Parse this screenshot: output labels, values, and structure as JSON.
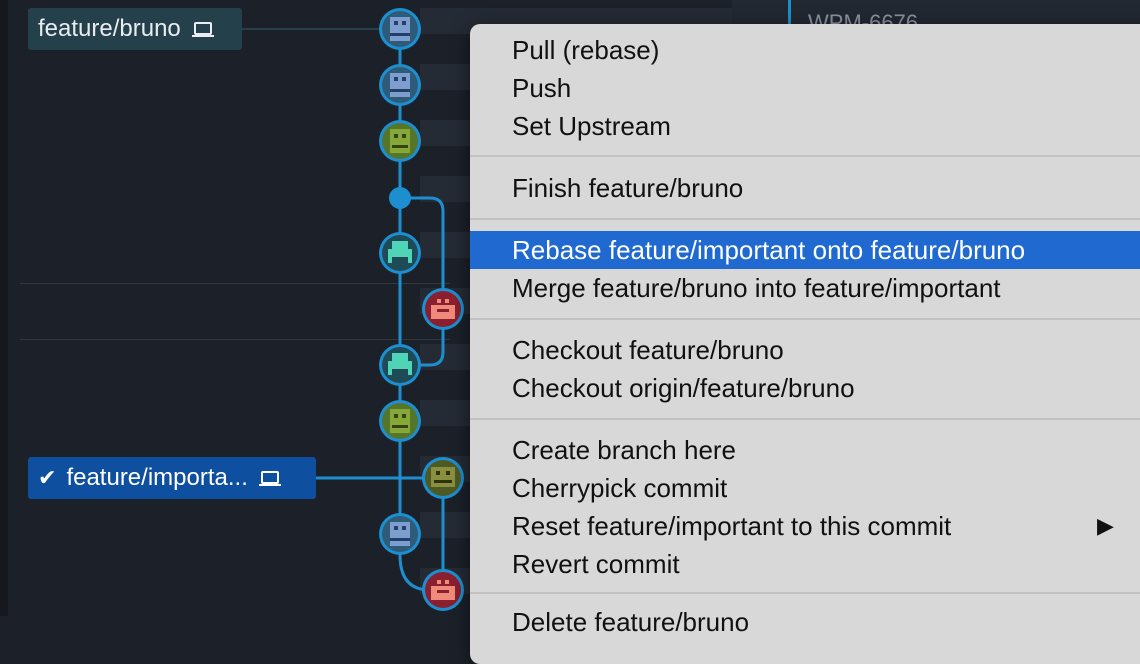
{
  "graph": {
    "branches": [
      {
        "label": "feature/bruno",
        "checked": false,
        "icon": "laptop-icon"
      },
      {
        "label": "feature/importa...",
        "checked": true,
        "icon": "laptop-icon"
      }
    ],
    "right_column_text": "WPM-6676"
  },
  "context_menu": {
    "items": [
      {
        "label": "Pull (rebase)"
      },
      {
        "label": "Push"
      },
      {
        "label": "Set Upstream"
      },
      {
        "label": "Finish feature/bruno"
      },
      {
        "label": "Rebase feature/important onto feature/bruno",
        "selected": true
      },
      {
        "label": "Merge feature/bruno into feature/important"
      },
      {
        "label": "Checkout feature/bruno"
      },
      {
        "label": "Checkout origin/feature/bruno"
      },
      {
        "label": "Create branch here"
      },
      {
        "label": "Cherrypick commit"
      },
      {
        "label": "Reset feature/important to this commit",
        "submenu": true,
        "submenu_glyph": "▶"
      },
      {
        "label": "Revert commit"
      },
      {
        "label": "Delete feature/bruno"
      }
    ]
  },
  "colors": {
    "background": "#1c2129",
    "graph_line": "#1d8fd0",
    "selected_branch": "#0e4fa0",
    "menu_background": "#d8d8d8",
    "menu_highlight": "#1f69d0"
  }
}
